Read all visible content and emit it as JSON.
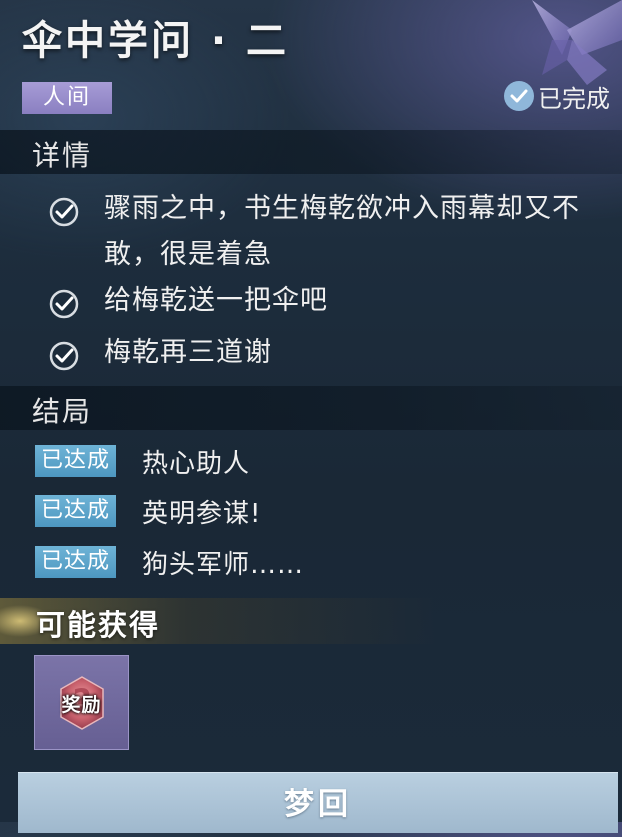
{
  "quest": {
    "title": "伞中学问 · 二",
    "category": "人间",
    "status": "已完成"
  },
  "details": {
    "header": "详情",
    "items": [
      {
        "text_line1": "骤雨之中，书生梅乾欲冲入雨幕却又不",
        "text_line2": "敢，很是着急",
        "checked": true
      },
      {
        "text": "给梅乾送一把伞吧",
        "checked": true
      },
      {
        "text": "梅乾再三道谢",
        "checked": true
      }
    ]
  },
  "endings": {
    "header": "结局",
    "items": [
      {
        "badge": "已达成",
        "name": "热心助人"
      },
      {
        "badge": "已达成",
        "name": "英明参谋!"
      },
      {
        "badge": "已达成",
        "name": "狗头军师……"
      }
    ]
  },
  "rewards": {
    "header": "可能获得",
    "items": [
      {
        "label": "奖励",
        "icon": "question-mark-gem-icon"
      }
    ]
  },
  "actions": {
    "dream_button": "梦回"
  },
  "colors": {
    "category_badge": "#8a7fc1",
    "achieved_badge": "#4d97c0",
    "reward_frame": "#665f93",
    "dream_button": "#9fb8cd"
  }
}
